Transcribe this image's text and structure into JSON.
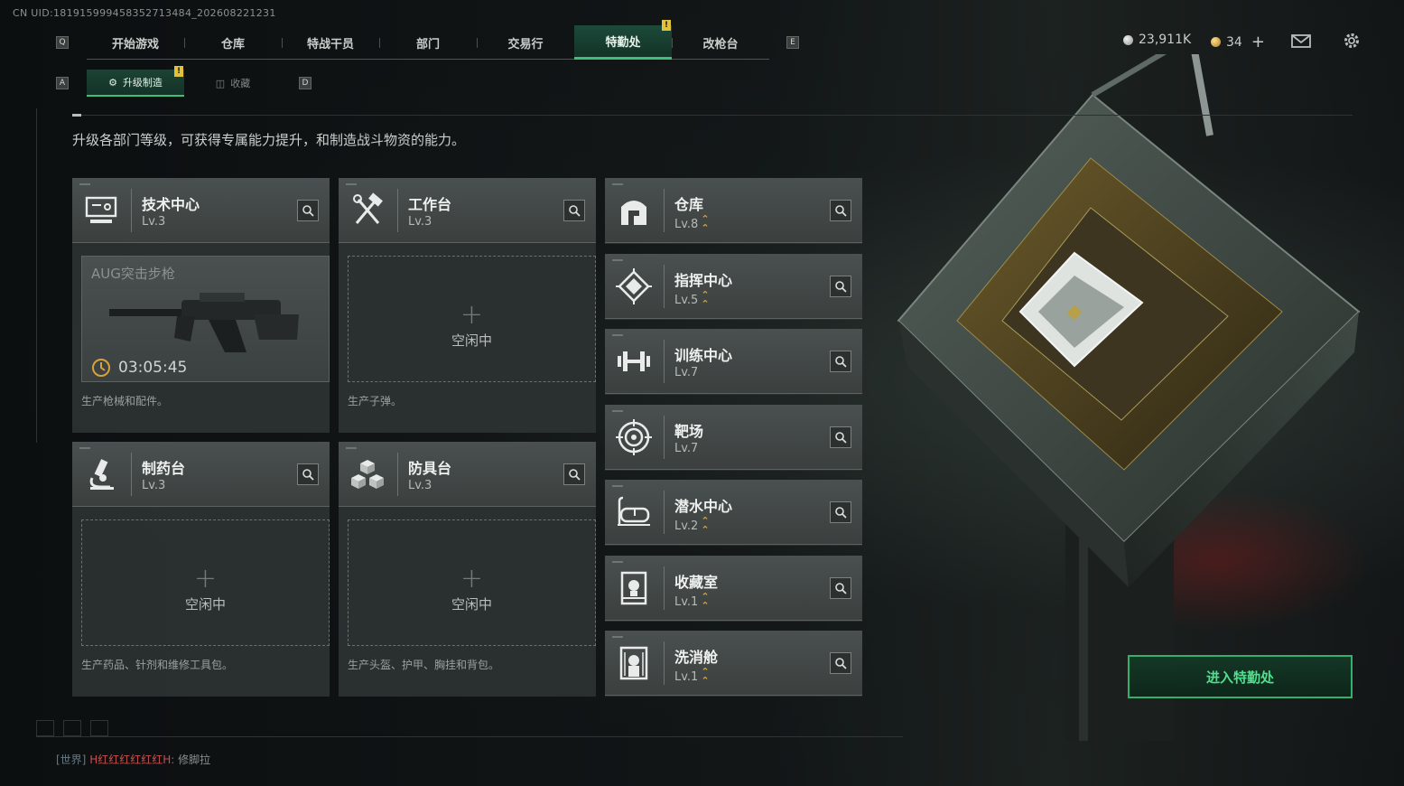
{
  "uid": "CN UID:181915999458352713484_202608221231",
  "nav": {
    "key_left": "Q",
    "key_right": "E",
    "tabs": [
      "开始游戏",
      "仓库",
      "特战干员",
      "部门",
      "交易行",
      "特勤处",
      "改枪台"
    ],
    "active_index": 5,
    "alert_mark": "!"
  },
  "currency": {
    "silver": "23,911K",
    "gold": "34",
    "add": "+"
  },
  "subnav": {
    "key_left": "A",
    "key_right": "D",
    "tabs": [
      {
        "label": "升级制造",
        "icon": "upgrade-icon",
        "active": true
      },
      {
        "label": "收藏",
        "icon": "collection-icon",
        "active": false
      }
    ]
  },
  "description": "升级各部门等级，可获得专属能力提升，和制造战斗物资的能力。",
  "production": [
    {
      "name": "技术中心",
      "level": "Lv.3",
      "icon": "monitor-icon",
      "slot_state": "busy",
      "item": "AUG突击步枪",
      "timer": "03:05:45",
      "desc": "生产枪械和配件。"
    },
    {
      "name": "工作台",
      "level": "Lv.3",
      "icon": "tools-icon",
      "slot_state": "idle",
      "idle_text": "空闲中",
      "desc": "生产子弹。"
    },
    {
      "name": "制药台",
      "level": "Lv.3",
      "icon": "microscope-icon",
      "slot_state": "idle",
      "idle_text": "空闲中",
      "desc": "生产药品、针剂和维修工具包。"
    },
    {
      "name": "防具台",
      "level": "Lv.3",
      "icon": "armor-cubes-icon",
      "slot_state": "idle",
      "idle_text": "空闲中",
      "desc": "生产头盔、护甲、胸挂和背包。"
    }
  ],
  "departments": [
    {
      "name": "仓库",
      "level": "Lv.8",
      "upgradable": true,
      "icon": "storage-icon"
    },
    {
      "name": "指挥中心",
      "level": "Lv.5",
      "upgradable": true,
      "icon": "command-icon"
    },
    {
      "name": "训练中心",
      "level": "Lv.7",
      "upgradable": false,
      "icon": "dumbbell-icon"
    },
    {
      "name": "靶场",
      "level": "Lv.7",
      "upgradable": false,
      "icon": "target-icon"
    },
    {
      "name": "潜水中心",
      "level": "Lv.2",
      "upgradable": true,
      "icon": "diving-mask-icon"
    },
    {
      "name": "收藏室",
      "level": "Lv.1",
      "upgradable": true,
      "icon": "collection-room-icon"
    },
    {
      "name": "洗消舱",
      "level": "Lv.1",
      "upgradable": true,
      "icon": "decontamination-icon"
    }
  ],
  "enter_button": "进入特勤处",
  "chat": {
    "channel": "[世界]",
    "user": "H红红红红红红H:",
    "message": "修脚拉"
  },
  "colors": {
    "accent_green": "#3ec07a",
    "upgrade_gold": "#d9a63a",
    "alert_yellow": "#e2c23a"
  }
}
